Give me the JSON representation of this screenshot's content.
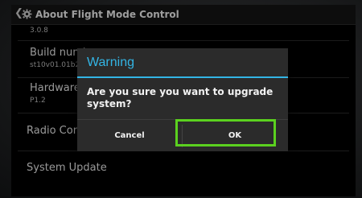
{
  "actionbar": {
    "back_glyph": "❮",
    "app_icon": "gear-icon",
    "title": "About Flight Mode Control"
  },
  "settings": {
    "version_value": "3.0.8",
    "build_title": "Build numb",
    "build_value": "st10v01.01b2",
    "hardware_title": "Hardware v",
    "hardware_value": "P1.2",
    "radio_title": "Radio Cont",
    "update_title": "System Update"
  },
  "dialog": {
    "title": "Warning",
    "message": "Are you sure you want to upgrade system?",
    "cancel_label": "Cancel",
    "ok_label": "OK",
    "accent_color": "#33b5e5",
    "highlight_color": "#5bd11f"
  }
}
